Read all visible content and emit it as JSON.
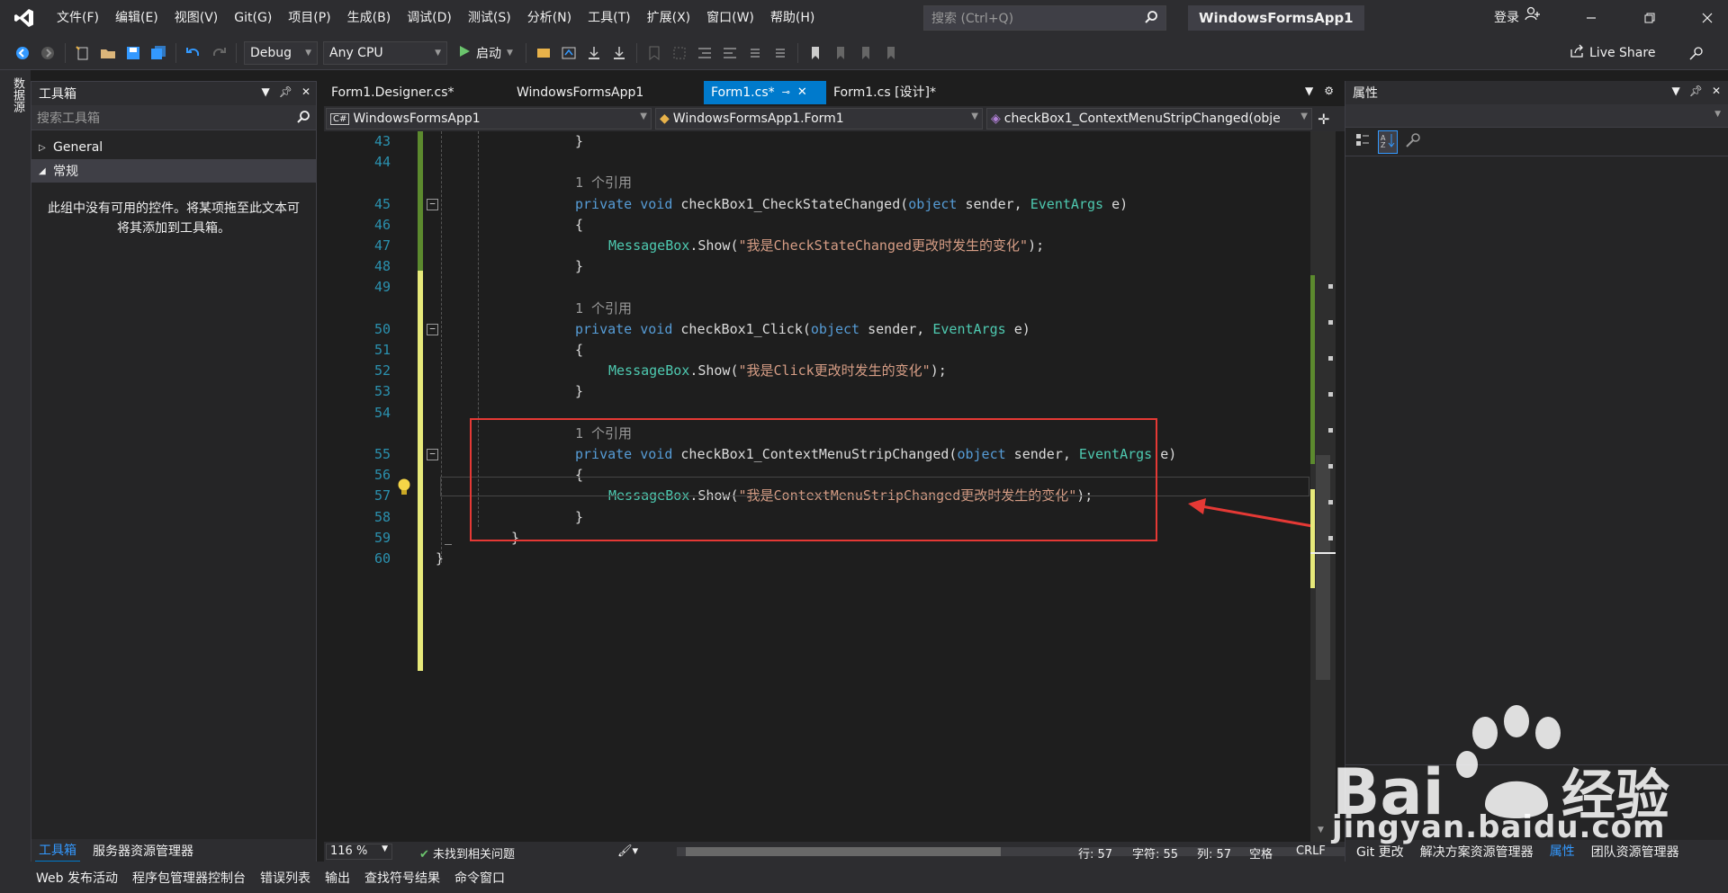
{
  "menu": {
    "items": [
      "文件(F)",
      "编辑(E)",
      "视图(V)",
      "Git(G)",
      "项目(P)",
      "生成(B)",
      "调试(D)",
      "测试(S)",
      "分析(N)",
      "工具(T)",
      "扩展(X)",
      "窗口(W)",
      "帮助(H)"
    ],
    "search_placeholder": "搜索 (Ctrl+Q)",
    "solution_title": "WindowsFormsApp1",
    "login": "登录"
  },
  "toolbar": {
    "config": "Debug",
    "platform": "Any CPU",
    "start": "启动",
    "live_share": "Live Share"
  },
  "left_strip": {
    "tab": "数据源"
  },
  "toolbox": {
    "title": "工具箱",
    "search_placeholder": "搜索工具箱",
    "groups": [
      {
        "label": "General",
        "expanded": false
      },
      {
        "label": "常规",
        "expanded": true
      }
    ],
    "empty_message": "此组中没有可用的控件。将某项拖至此文本可将其添加到工具箱。",
    "bottom_tabs": [
      "工具箱",
      "服务器资源管理器"
    ]
  },
  "doc_tabs": [
    {
      "label": "Form1.Designer.cs*",
      "active": false
    },
    {
      "label": "WindowsFormsApp1",
      "active": false
    },
    {
      "label": "Form1.cs*",
      "active": true
    },
    {
      "label": "Form1.cs [设计]*",
      "active": false
    }
  ],
  "navbar": {
    "project": "WindowsFormsApp1",
    "class": "WindowsFormsApp1.Form1",
    "member": "checkBox1_ContextMenuStripChanged(obje"
  },
  "code": {
    "lines": [
      {
        "num": "43",
        "text": "}",
        "indent": 2
      },
      {
        "num": "44",
        "text": "",
        "indent": 0
      },
      {
        "codelens": "1 个引用"
      },
      {
        "num": "45",
        "kind": "decl",
        "name": "checkBox1_CheckStateChanged"
      },
      {
        "num": "46",
        "text": "{",
        "indent": 2
      },
      {
        "num": "47",
        "kind": "call",
        "msg": "\"我是CheckStateChanged更改时发生的变化\""
      },
      {
        "num": "48",
        "text": "}",
        "indent": 2
      },
      {
        "num": "49",
        "text": "",
        "indent": 0
      },
      {
        "codelens": "1 个引用"
      },
      {
        "num": "50",
        "kind": "decl",
        "name": "checkBox1_Click"
      },
      {
        "num": "51",
        "text": "{",
        "indent": 2
      },
      {
        "num": "52",
        "kind": "call",
        "msg": "\"我是Click更改时发生的变化\""
      },
      {
        "num": "53",
        "text": "}",
        "indent": 2
      },
      {
        "num": "54",
        "text": "",
        "indent": 0
      },
      {
        "codelens": "1 个引用"
      },
      {
        "num": "55",
        "kind": "decl",
        "name": "checkBox1_ContextMenuStripChanged"
      },
      {
        "num": "56",
        "text": "{",
        "indent": 2
      },
      {
        "num": "57",
        "kind": "call",
        "msg": "\"我是ContextMenuStripChanged更改时发生的变化\""
      },
      {
        "num": "58",
        "text": "}",
        "indent": 2
      },
      {
        "num": "59",
        "text": "}",
        "indent": 1
      },
      {
        "num": "60",
        "text": "}",
        "indent": 0
      }
    ],
    "kw_private": "private",
    "kw_void": "void",
    "kw_object": "object",
    "param_sender": "sender,",
    "type_eventargs": "EventArgs",
    "param_e": "e)",
    "call_class": "MessageBox",
    "call_method": ".Show(",
    "call_end": ");"
  },
  "editor_status": {
    "zoom": "116 %",
    "issues": "未找到相关问题",
    "line": "行: 57",
    "char": "字符: 55",
    "col": "列: 57",
    "space": "空格",
    "eol": "CRLF"
  },
  "properties": {
    "title": "属性",
    "bottom_tabs": [
      "Git 更改",
      "解决方案资源管理器",
      "属性",
      "团队资源管理器"
    ]
  },
  "bottom_bar": [
    "Web 发布活动",
    "程序包管理器控制台",
    "错误列表",
    "输出",
    "查找符号结果",
    "命令窗口"
  ],
  "watermark": {
    "brand": "Bai du 经验",
    "url": "jingyan.baidu.com"
  },
  "colors": {
    "accent": "#007acc",
    "highlight_box": "#e53935",
    "keyword": "#569cd6",
    "type": "#4ec9b0",
    "string": "#d69d85"
  }
}
